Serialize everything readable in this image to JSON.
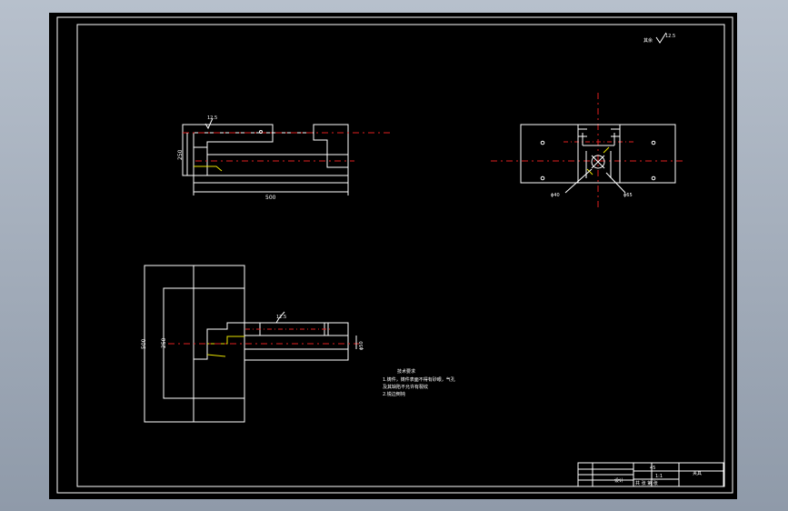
{
  "colors": {
    "background": "#000000",
    "outline": "#ffffff",
    "centerline": "#e02020",
    "highlight": "#e8e200"
  },
  "roughness_note": {
    "label": "其余",
    "value": "12.5"
  },
  "front_view": {
    "surface_finish": "12.5",
    "height_dim": "250",
    "width_dim": "500"
  },
  "top_view": {
    "dia_left": "ϕ40",
    "dia_right": "ϕ65"
  },
  "side_view": {
    "height_dim": "500",
    "inner_dim": "250",
    "surface_finish": "12.5",
    "dia_dim": "ϕ50"
  },
  "tech_requirements": {
    "title": "技术要求",
    "line1": "1.铸件，铸件表面不得有砂眼，气孔",
    "line2": "及其缺陷不允许有裂纹",
    "line3": "2.锐边倒钝"
  },
  "title_block": {
    "material": "45",
    "ratio": "1:1",
    "name": "夹具",
    "designer": "设计",
    "footer": "共  张  第  张"
  }
}
